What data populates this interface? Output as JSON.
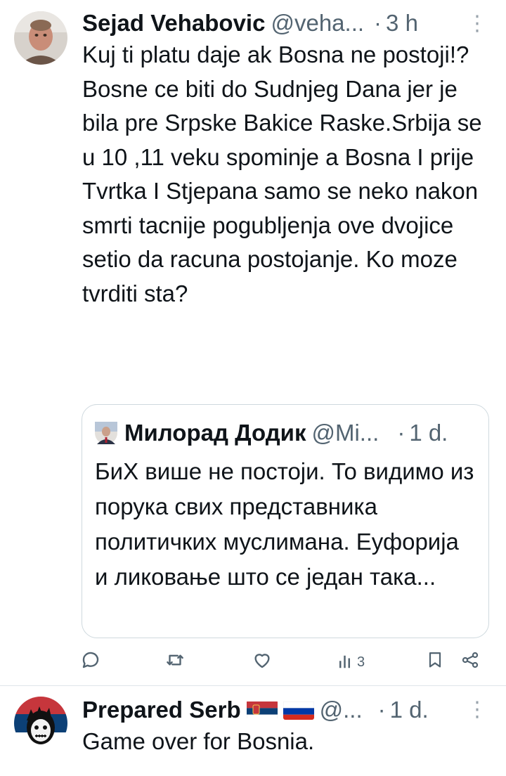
{
  "tweet1": {
    "name": "Sejad Vehabovic",
    "handle": "@veha...",
    "dot": "·",
    "time": "3 h",
    "more": "⋮",
    "body": "Kuj ti platu daje ak Bosna ne postoji!? Bosne ce biti do Sudnjeg Dana jer je bila pre Srpske Bakice Raske.Srbija se u 10 ,11 veku spominje a Bosna I prije Tvrtka I Stjepana samo se neko nakon smrti   tacnije pogubljenja ove dvojice setio da racuna postojanje. Ko moze tvrditi sta?",
    "quote": {
      "name": "Милорад Додик",
      "handle": "@Mi...",
      "dot": "·",
      "time": "1 d.",
      "body": "БиХ више не постоји. То видимо из порука свих представника политичких муслимана. Еуфорија и ликовање што се један така..."
    },
    "actions": {
      "reply_icon": "reply-icon",
      "retweet_icon": "retweet-icon",
      "like_icon": "like-icon",
      "views_icon": "views-icon",
      "views_count": "3",
      "bookmark_icon": "bookmark-icon",
      "share_icon": "share-icon"
    }
  },
  "tweet2": {
    "name": "Prepared Serb",
    "flags": [
      "serbia-flag",
      "russia-flag"
    ],
    "handle": "@...",
    "dot": "·",
    "time": "1 d.",
    "more": "⋮",
    "body": "Game over for Bosnia."
  },
  "colors": {
    "text": "#0f1419",
    "secondary": "#536471",
    "border": "#cfd9de"
  }
}
